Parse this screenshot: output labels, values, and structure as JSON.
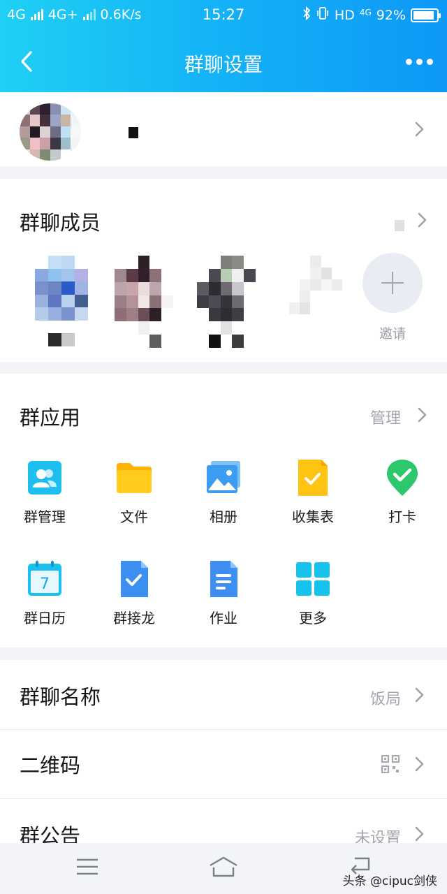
{
  "status_bar": {
    "sim1": "4G",
    "sim2": "4G+",
    "speed": "0.6K/s",
    "time": "15:27",
    "hd": "HD",
    "net": "4G",
    "battery_text": "92%",
    "battery_level": 0.92
  },
  "header": {
    "title": "群聊设置",
    "back_icon": "back-chevron-icon",
    "more_icon": "more-dots-icon"
  },
  "members": {
    "title": "群聊成员",
    "invite_label": "邀请"
  },
  "apps": {
    "title": "群应用",
    "manage_label": "管理",
    "items": [
      {
        "label": "群管理",
        "icon": "group-manage-icon"
      },
      {
        "label": "文件",
        "icon": "folder-icon"
      },
      {
        "label": "相册",
        "icon": "album-icon"
      },
      {
        "label": "收集表",
        "icon": "form-collect-icon"
      },
      {
        "label": "打卡",
        "icon": "check-in-icon"
      },
      {
        "label": "群日历",
        "icon": "calendar-icon"
      },
      {
        "label": "群接龙",
        "icon": "relay-icon"
      },
      {
        "label": "作业",
        "icon": "homework-icon"
      },
      {
        "label": "更多",
        "icon": "more-apps-icon"
      }
    ],
    "calendar_day": "7"
  },
  "settings": {
    "group_name_label": "群聊名称",
    "group_name_value": "饭局",
    "qr_label": "二维码",
    "notice_label": "群公告",
    "notice_value": "未设置"
  },
  "watermark": "头条 @cipuc剑侠",
  "colors": {
    "header_start": "#1fd0f4",
    "header_end": "#0e98f7",
    "accent_blue": "#2b8cf0",
    "folder_yellow": "#ffc312",
    "checkin_green": "#2dc86b"
  }
}
